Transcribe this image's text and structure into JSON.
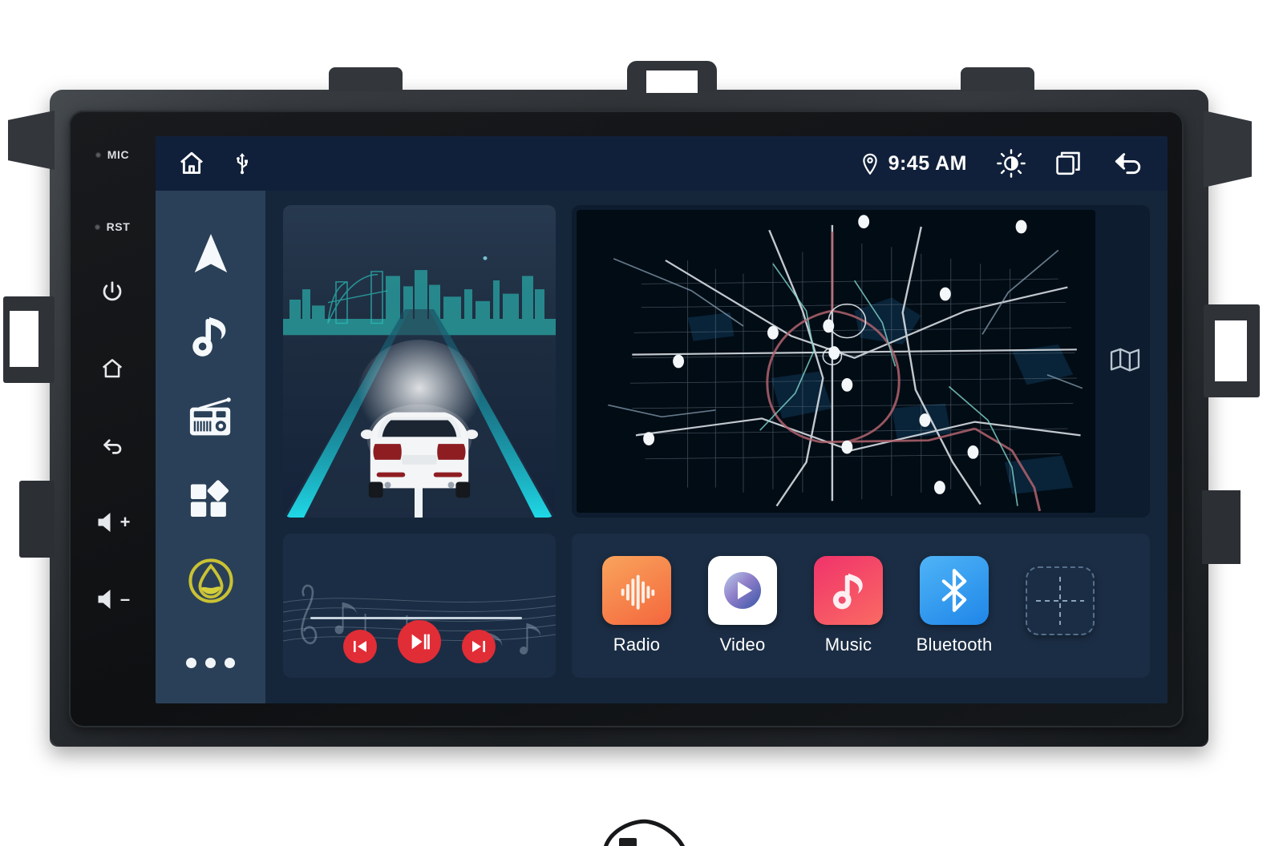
{
  "device": {
    "name": "android-car-head-unit",
    "hard_keys": [
      {
        "id": "mic",
        "label": "MIC",
        "type": "led-label"
      },
      {
        "id": "rst",
        "label": "RST",
        "type": "led-label"
      },
      {
        "id": "power",
        "label": "",
        "icon": "power-icon"
      },
      {
        "id": "home",
        "label": "",
        "icon": "home-outline-icon"
      },
      {
        "id": "back",
        "label": "",
        "icon": "back-arrow-icon"
      },
      {
        "id": "vol-up",
        "label": "+",
        "icon": "volume-up-icon"
      },
      {
        "id": "vol-down",
        "label": "–",
        "icon": "volume-down-icon"
      }
    ]
  },
  "statusbar": {
    "home_icon": "home-icon",
    "usb_icon": "usb-icon",
    "location_icon": "location-pin-icon",
    "time": "9:45 AM",
    "brightness_icon": "brightness-icon",
    "recents_icon": "recent-apps-icon",
    "back_icon": "back-arrow-icon"
  },
  "rail": {
    "items": [
      {
        "name": "navigation",
        "icon": "navigation-arrow-icon"
      },
      {
        "name": "music",
        "icon": "music-note-icon"
      },
      {
        "name": "radio",
        "icon": "radio-icon"
      },
      {
        "name": "apps",
        "icon": "apps-grid-icon"
      },
      {
        "name": "oil",
        "icon": "oil-drop-icon",
        "color": "#c9c233"
      },
      {
        "name": "more",
        "icon": "more-dots-icon"
      }
    ]
  },
  "widgets": {
    "drive": {
      "name": "lane-assist-widget",
      "scene": "night-highway-with-city-skyline",
      "vehicle_color": "#f2f4f6",
      "lane_marker_color": "#1fd8e6"
    },
    "map": {
      "name": "navigation-map-widget",
      "style": "dark",
      "map_icon": "folded-map-icon",
      "poi_count": 12
    },
    "music": {
      "name": "media-player-widget",
      "prev_icon": "skip-previous-icon",
      "play_icon": "play-pause-icon",
      "next_icon": "skip-next-icon",
      "button_color": "#e12d36",
      "progress_percent": 0
    }
  },
  "apps": [
    {
      "label": "Radio",
      "icon": "radio-waveform-icon",
      "color": "#f4663d"
    },
    {
      "label": "Video",
      "icon": "play-circle-icon",
      "color": "#ffffff"
    },
    {
      "label": "Music",
      "icon": "music-note-icon",
      "color": "#f0336b"
    },
    {
      "label": "Bluetooth",
      "icon": "bluetooth-icon",
      "color": "#1f86e8"
    },
    {
      "label": "",
      "icon": "add-shortcut-icon",
      "color": "#54708c"
    }
  ],
  "colors": {
    "screen_bg": "#15263a",
    "statusbar_bg": "#11203a",
    "rail_bg": "#2a4058",
    "card_bg": "#1b2d44",
    "accent_red": "#e12d36",
    "accent_cyan": "#1fd8e6"
  }
}
